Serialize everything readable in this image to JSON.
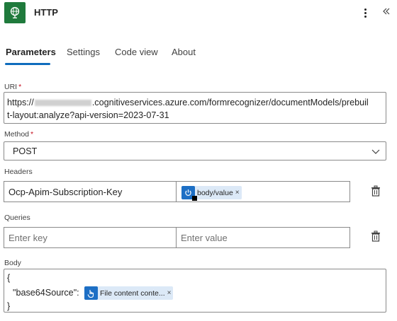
{
  "header": {
    "title": "HTTP",
    "icon": "globe-icon",
    "brand_color": "#1f7a3c"
  },
  "tabs": [
    {
      "label": "Parameters",
      "active": true
    },
    {
      "label": "Settings",
      "active": false
    },
    {
      "label": "Code view",
      "active": false
    },
    {
      "label": "About",
      "active": false
    }
  ],
  "accent_color": "#0f6cbd",
  "uri": {
    "label": "URI",
    "required": "*",
    "value_prefix": "https://",
    "value_line1_rest": ".cognitiveservices.azure.com/formrecognizer/documentModels/prebuil",
    "value_line2": "t-layout:analyze?api-version=2023-07-31"
  },
  "method": {
    "label": "Method",
    "required": "*",
    "value": "POST"
  },
  "headers": {
    "label": "Headers",
    "key": "Ocp-Apim-Subscription-Key",
    "value_token": {
      "label": "body/value",
      "icon": "power-icon",
      "remove": "×"
    }
  },
  "queries": {
    "label": "Queries",
    "key_placeholder": "Enter key",
    "value_placeholder": "Enter value"
  },
  "body": {
    "label": "Body",
    "line1": "{",
    "line2_key": "\"base64Source\":",
    "token": {
      "label": "File content conte...",
      "icon": "hand-pointer-icon",
      "remove": "×"
    },
    "line3": "}"
  }
}
